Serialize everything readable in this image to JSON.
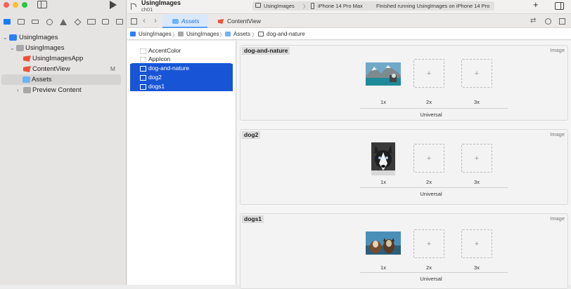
{
  "toolbar": {
    "project_name": "UsingImages",
    "branch": "ch01",
    "scheme_app": "UsingImages",
    "scheme_device": "iPhone 14 Pro Max",
    "status": "Finished running UsingImages on iPhone 14 Pro",
    "add_label": "+"
  },
  "tabs": [
    {
      "label": "Assets"
    },
    {
      "label": "ContentView"
    }
  ],
  "navigator": {
    "items": [
      {
        "label": "UsingImages"
      },
      {
        "label": "UsingImages"
      },
      {
        "label": "UsingImagesApp"
      },
      {
        "label": "ContentView",
        "badge": "M"
      },
      {
        "label": "Assets"
      },
      {
        "label": "Preview Content"
      }
    ]
  },
  "breadcrumb": [
    "UsingImages",
    "UsingImages",
    "Assets",
    "dog-and-nature"
  ],
  "asset_list": [
    "AccentColor",
    "AppIcon",
    "dog-and-nature",
    "dog2",
    "dogs1"
  ],
  "asset_sets": [
    {
      "name": "dog-and-nature",
      "kind": "Image",
      "slots": [
        "1x",
        "2x",
        "3x"
      ],
      "universal": "Universal"
    },
    {
      "name": "dog2",
      "kind": "Image",
      "slots": [
        "1x",
        "2x",
        "3x"
      ],
      "universal": "Universal"
    },
    {
      "name": "dogs1",
      "kind": "Image",
      "slots": [
        "1x",
        "2x",
        "3x"
      ],
      "universal": "Universal"
    }
  ],
  "colors": {
    "accent": "#1855d6",
    "selection": "#d6d4d2"
  }
}
